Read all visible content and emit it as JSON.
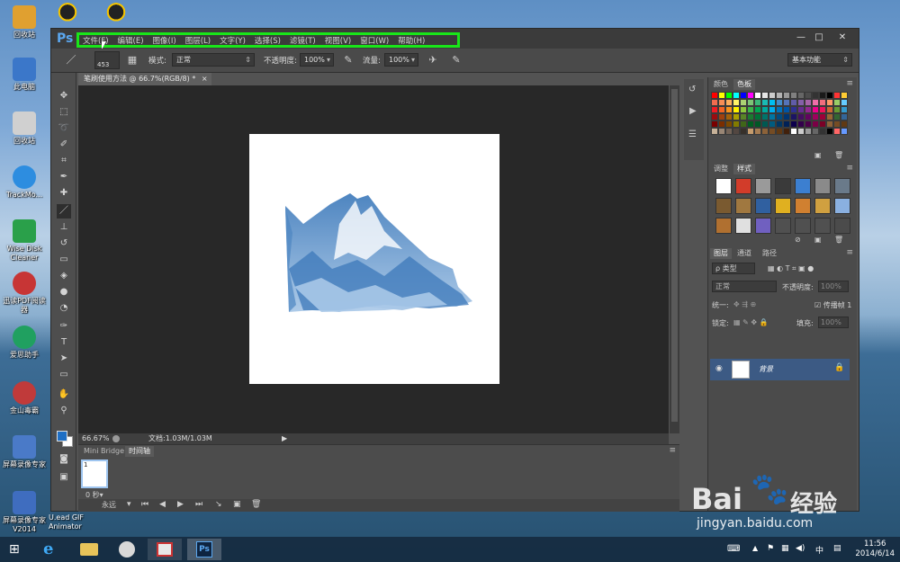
{
  "desktop": {
    "icons": [
      {
        "label": "回收站",
        "color": "#e0a030"
      },
      {
        "label": "此电脑",
        "color": "#3b77c9"
      },
      {
        "label": "回收站",
        "color": "#d0d0d0"
      },
      {
        "label": "TrackMo...",
        "color": "#2d8de0"
      },
      {
        "label": "Wise Disk Cleaner",
        "color": "#2aa04a"
      },
      {
        "label": "迅读PDF阅读器",
        "color": "#c73535"
      },
      {
        "label": "爱思助手",
        "color": "#20a060"
      },
      {
        "label": "金山毒霸",
        "color": "#c03a3a"
      },
      {
        "label": "屏幕录像专家",
        "color": "#4a7ac8"
      },
      {
        "label": "屏幕录像专家V2014",
        "color": "#3f6dbf"
      }
    ],
    "top_icons": [
      {
        "label": "QQ",
        "color": "#111"
      },
      {
        "label": "QQ",
        "color": "#111"
      }
    ],
    "gif_label": "U.ead GIF Animator"
  },
  "ps": {
    "logo": "Ps",
    "menu": [
      "文件(F)",
      "编辑(E)",
      "图像(I)",
      "图层(L)",
      "文字(Y)",
      "选择(S)",
      "滤镜(T)",
      "视图(V)",
      "窗口(W)",
      "帮助(H)"
    ],
    "window_buttons": [
      "—",
      "□",
      "✕"
    ],
    "options": {
      "brush_size": "453",
      "mode_label": "模式:",
      "mode_value": "正常",
      "opacity_label": "不透明度:",
      "opacity_value": "100%",
      "flow_label": "流量:",
      "flow_value": "100%",
      "workspace": "基本功能"
    },
    "doc_tab": "笔刷使用方法 @ 66.7%(RGB/8) *",
    "doc_tab_close": "×",
    "status": {
      "zoom": "66.67%",
      "doc": "文档:1.03M/1.03M"
    },
    "bottom_panel": {
      "tabs": [
        "Mini Bridge",
        "时间轴"
      ],
      "frame_index": "1",
      "frame_delay": "0 秒▾",
      "loop": "永远"
    },
    "right_panel": {
      "color_tabs": [
        "颜色",
        "色板"
      ],
      "adjust_tabs": [
        "调整",
        "样式"
      ],
      "layer_tabs": [
        "图层",
        "通道",
        "路径"
      ],
      "filter_kind": "ρ 类型",
      "blend_mode": "正常",
      "opacity_label": "不透明度:",
      "opacity_value": "100%",
      "unify_label": "统一:",
      "propagate_label": "传播帧 1",
      "lock_label": "锁定:",
      "fill_label": "填充:",
      "fill_value": "100%",
      "layer_name": "背景"
    },
    "swatch_colors": [
      "#ff0000",
      "#ffff00",
      "#00ff00",
      "#00ffff",
      "#0000ff",
      "#ff00ff",
      "#ffffff",
      "#e6e6e6",
      "#cccccc",
      "#b3b3b3",
      "#999999",
      "#808080",
      "#666666",
      "#4d4d4d",
      "#333333",
      "#1a1a1a",
      "#000000",
      "#ff3333",
      "#ffcc33",
      "#f26c4f",
      "#f68e55",
      "#fbaf5d",
      "#fff467",
      "#acd373",
      "#7cc576",
      "#3bb878",
      "#1abbb4",
      "#00bff3",
      "#438ccb",
      "#5574b9",
      "#605ca8",
      "#855fa8",
      "#a763a8",
      "#f06ea9",
      "#f26d7d",
      "#ff9966",
      "#99cc66",
      "#66ccff",
      "#ed1c24",
      "#f26522",
      "#f7941d",
      "#fff200",
      "#8dc73f",
      "#39b54a",
      "#00a651",
      "#00a99d",
      "#00aeef",
      "#0072bc",
      "#0054a6",
      "#2e3192",
      "#662d91",
      "#92278f",
      "#ec008c",
      "#ed145b",
      "#cc6633",
      "#669933",
      "#3399cc",
      "#9e0b0f",
      "#a0410d",
      "#a36209",
      "#aba000",
      "#598527",
      "#1a7b30",
      "#007236",
      "#00746b",
      "#0076a3",
      "#004b80",
      "#003471",
      "#1b1464",
      "#440e62",
      "#630460",
      "#9e005d",
      "#9e0039",
      "#996633",
      "#336633",
      "#336699",
      "#790000",
      "#7b2e00",
      "#7d4900",
      "#827b00",
      "#406618",
      "#005e20",
      "#005826",
      "#005952",
      "#005b7f",
      "#003663",
      "#002157",
      "#0d004c",
      "#32004b",
      "#4b0049",
      "#7b0046",
      "#7a0026",
      "#8c6239",
      "#754c24",
      "#603913",
      "#c7b299",
      "#998675",
      "#736357",
      "#534741",
      "#37302a",
      "#c69c6d",
      "#a67c52",
      "#8c6239",
      "#754c24",
      "#603913",
      "#42210b",
      "#ffffff",
      "#cccccc",
      "#999999",
      "#666666",
      "#333333",
      "#000000",
      "#ff6666",
      "#6699ff"
    ],
    "style_colors": [
      "#ffffff",
      "#d23c2a",
      "#9a9a9a",
      "#3a3a3a",
      "#3c7fd0",
      "#8a8a8a",
      "#6a7a8a",
      "#7a5a30",
      "#a07840",
      "#3060a0",
      "#e0b020",
      "#d08030",
      "#d0a040",
      "#8ab0e0",
      "#b07030",
      "#e0e0e0",
      "#7060c0",
      "#505050",
      "#505050",
      "#505050",
      "#4b4b4b"
    ]
  },
  "taskbar": {
    "time": "11:56",
    "date": "2014/6/14",
    "ime": "中"
  },
  "watermark": {
    "brand": "Bai",
    "brand2": "经验",
    "url": "jingyan.baidu.com"
  }
}
